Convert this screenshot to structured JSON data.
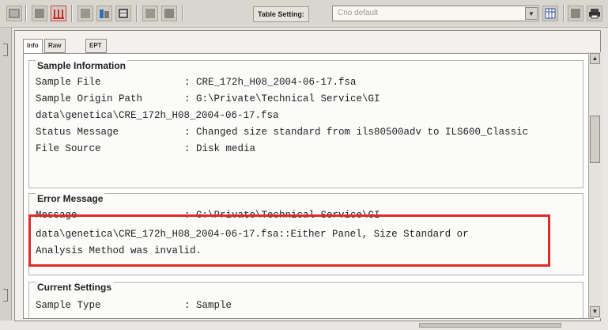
{
  "toolbar": {
    "table_setting_label": "Table Setting:",
    "table_setting_value": "Cno default",
    "icons": [
      "grid-icon",
      "bar-icon",
      "columns-icon",
      "panel-icon",
      "chart-icon",
      "table-icon",
      "save-icon",
      "copy-icon",
      "table-view-icon",
      "layout-icon",
      "print-icon"
    ]
  },
  "tabs": [
    {
      "label": "Info",
      "active": true
    },
    {
      "label": "Raw Data",
      "active": false
    },
    {
      "label": "EPT Data",
      "active": false
    }
  ],
  "sample_information": {
    "title": "Sample Information",
    "rows": [
      {
        "key": "Sample File",
        "value": ": CRE_172h_H08_2004-06-17.fsa"
      },
      {
        "key": "Sample Origin Path",
        "value": ": G:\\Private\\Technical Service\\GI"
      },
      {
        "key": "",
        "value": "data\\genetica\\CRE_172h_H08_2004-06-17.fsa"
      },
      {
        "key": "Status Message",
        "value": ": Changed size standard from ils80500adv to ILS600_Classic"
      },
      {
        "key": "File Source",
        "value": ": Disk media"
      }
    ]
  },
  "error_message": {
    "title": "Error Message",
    "rows": [
      {
        "key": "Message",
        "value": ": G:\\Private\\Technical Service\\GI"
      },
      {
        "key": "",
        "value": "data\\genetica\\CRE_172h_H08_2004-06-17.fsa::Either Panel, Size Standard or"
      },
      {
        "key": "",
        "value": "Analysis Method was invalid."
      }
    ]
  },
  "current_settings": {
    "title": "Current Settings",
    "rows": [
      {
        "key": "Sample Type",
        "value": ": Sample"
      }
    ]
  },
  "colors": {
    "highlight": "#e02a2a"
  }
}
